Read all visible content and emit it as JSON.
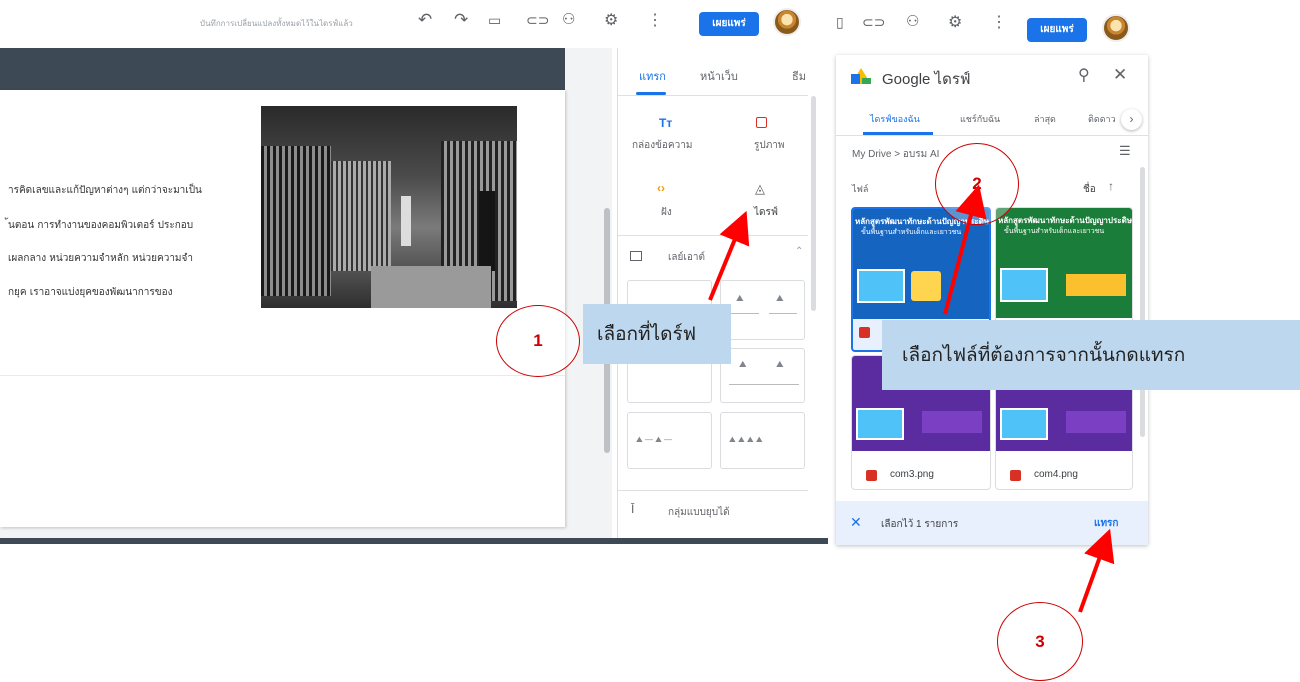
{
  "toolbar": {
    "status": "บันทึกการเปลี่ยนแปลงทั้งหมดไว้ในไดรฟ์แล้ว",
    "publish_label": "เผยแพร่"
  },
  "editor": {
    "body_lines": [
      "ารคิดเลขและแก้ปัญหาต่างๆ แต่กว่าจะมาเป็น",
      "้นตอน การทำงานของคอมพิวเตอร์ ประกอบ",
      "เผลกลาง หน่วยความจำหลัก หน่วยความจำ",
      "กยุค เราอาจแบ่งยุคของพัฒนาการของ"
    ]
  },
  "insert_panel": {
    "tabs": [
      "แทรก",
      "หน้าเว็บ",
      "ธีม"
    ],
    "items": {
      "textbox": "กล่องข้อความ",
      "image": "รูปภาพ",
      "embed": "ฝัง",
      "drive": "ไดรฟ์"
    },
    "layouts_label": "เลย์เอาต์",
    "collapsible_label": "กลุ่มแบบยุบได้",
    "icons": {
      "textbox": "Tт",
      "embed": "‹›"
    }
  },
  "drive_picker": {
    "title": "Google ไดรฟ์",
    "tabs": [
      "ไดรฟ์ของฉัน",
      "แชร์กับฉัน",
      "ล่าสุด",
      "ติดดาว"
    ],
    "breadcrumb_root": "My Drive",
    "breadcrumb_sep": ">",
    "breadcrumb_folder": "อบรม AI",
    "files_label": "ไฟล์",
    "sort_label": "ชื่อ",
    "thumb_text_a": "หลักสูตรพัฒนาทักษะด้านปัญญาประดิษฐ์",
    "thumb_text_b": "ขั้นพื้นฐานสำหรับเด็กและเยาวชน",
    "files": [
      "com3.png",
      "com4.png"
    ],
    "selected_text": "เลือกไว้ 1 รายการ",
    "insert_label": "แทรก"
  },
  "annotations": {
    "callout1": "เลือกที่ไดร์ฟ",
    "callout2": "เลือกไฟล์ที่ต้องการจากนั้นกดแทรก",
    "step1": "1",
    "step2": "2",
    "step3": "3"
  },
  "colors": {
    "accent": "#1a73e8",
    "callout_bg": "#bdd7ee",
    "arrow": "#ff0000",
    "thumb_blue": "#1565c0",
    "thumb_green": "#1b7d3a",
    "thumb_purple": "#5b2ca0"
  }
}
